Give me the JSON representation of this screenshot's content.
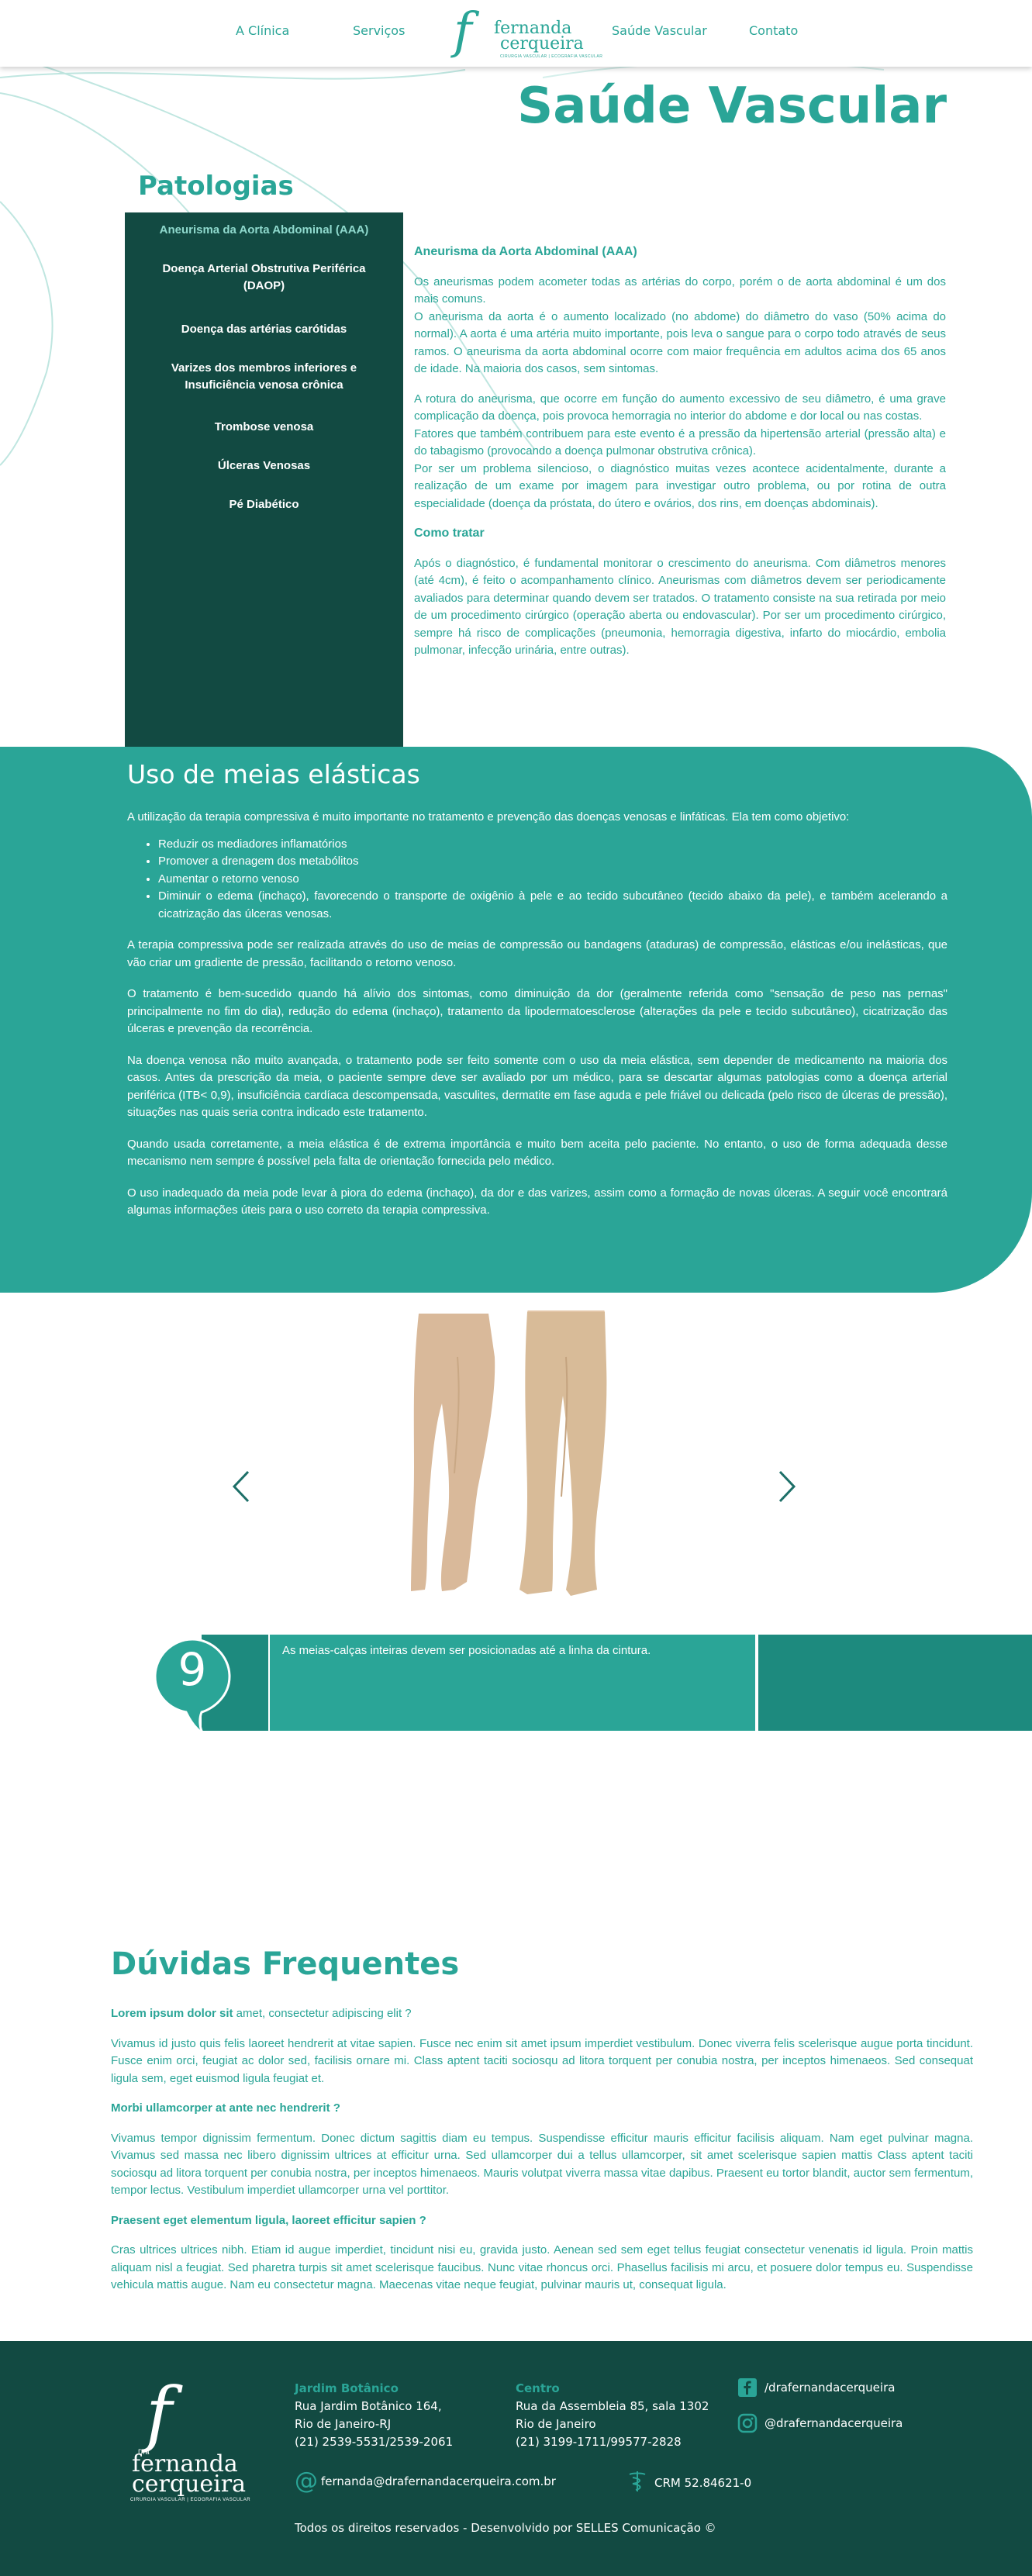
{
  "nav": {
    "clinica": "A Clínica",
    "servicos": "Serviços",
    "saude_vascular": "Saúde Vascular",
    "contato": "Contato"
  },
  "logo": {
    "line1": "fernanda",
    "line2": "cerqueira",
    "tagline": "CIRURGIA VASCULAR | ECOGRAFIA VASCULAR"
  },
  "page_title": "Saúde Vascular",
  "patologias": {
    "title": "Patologias",
    "items": [
      "Aneurisma da Aorta Abdominal (AAA)",
      "Doença Arterial Obstrutiva Periférica (DAOP)",
      "Doença das artérias carótidas",
      "Varizes dos membros inferiores e Insuficiência venosa crônica",
      "Trombose venosa",
      "Úlceras Venosas",
      "Pé Diabético"
    ]
  },
  "content": {
    "heading": "Aneurisma da Aorta Abdominal (AAA)",
    "p1": "Os aneurismas podem acometer todas as artérias do corpo, porém o de aorta abdominal é um dos mais comuns.",
    "p2": "O aneurisma da aorta é o aumento localizado (no abdome) do diâmetro do vaso (50% acima do normal). A aorta é uma artéria muito importante, pois leva o sangue para o corpo todo através de seus ramos. O aneurisma da aorta abdominal ocorre com maior frequência em adultos acima dos 65 anos de idade. Na maioria dos casos, sem sintomas.",
    "p3": "A rotura do aneurisma, que ocorre em função do aumento excessivo de seu diâmetro, é uma grave complicação da doença, pois provoca hemorragia no interior do abdome e dor local ou nas costas.",
    "p4": "Fatores que também contribuem para este evento é a pressão da hipertensão arterial (pressão alta) e do tabagismo (provocando a doença pulmonar obstrutiva crônica).",
    "p5": "Por ser um problema silencioso, o diagnóstico muitas vezes acontece acidentalmente, durante a realização de um exame por imagem para investigar outro problema, ou por rotina de outra especialidade (doença da próstata, do útero e ovários, dos rins, em doenças abdominais).",
    "heading2": "Como tratar",
    "p6": "Após o diagnóstico, é fundamental monitorar o crescimento do aneurisma. Com diâmetros menores (até 4cm), é feito o acompanhamento clínico. Aneurismas com diâmetros devem ser periodicamente avaliados para determinar quando devem ser tratados. O tratamento consiste na sua retirada por meio de um procedimento cirúrgico (operação aberta ou endovascular). Por ser um procedimento cirúrgico, sempre há risco de complicações (pneumonia, hemorragia digestiva, infarto do miocárdio, embolia pulmonar, infecção urinária, entre outras)."
  },
  "meias": {
    "title": "Uso de meias elásticas",
    "intro": "A utilização da terapia compressiva é muito importante no tratamento e prevenção das doenças venosas e linfáticas. Ela tem como objetivo:",
    "bullets": [
      "Reduzir os mediadores inflamatórios",
      "Promover a drenagem dos metabólitos",
      "Aumentar o retorno venoso",
      "Diminuir o edema (inchaço), favorecendo o transporte de oxigênio à pele e ao tecido subcutâneo (tecido abaixo da pele), e também acelerando a cicatrização das úlceras venosas."
    ],
    "p1": "A terapia compressiva pode ser realizada através do uso de meias de compressão ou bandagens (ataduras) de compressão, elásticas e/ou inelásticas, que vão criar um gradiente de pressão, facilitando o retorno venoso.",
    "p2": "O tratamento é bem-sucedido quando há alívio dos sintomas, como diminuição da dor (geralmente referida como \"sensação de peso nas pernas\" principalmente no fim do dia), redução do edema (inchaço), tratamento da lipodermatoesclerose (alterações da pele e tecido subcutâneo), cicatrização das úlceras e prevenção da recorrência.",
    "p3": "Na doença venosa não muito avançada, o tratamento pode ser feito somente com o uso da meia elástica, sem depender de medicamento na maioria dos casos. Antes da prescrição da meia, o paciente sempre deve ser avaliado por um médico, para se descartar algumas patologias como a doença arterial periférica (ITB< 0,9), insuficiência cardíaca descompensada, vasculites, dermatite em fase aguda e pele friável ou delicada (pelo risco de úlceras de pressão), situações nas quais seria contra indicado este tratamento.",
    "p4": "Quando usada corretamente, a meia elástica é de extrema importância e muito bem aceita pelo paciente. No entanto, o uso de forma adequada desse mecanismo nem sempre é possível pela falta de orientação fornecida pelo médico.",
    "p5": "O uso inadequado da meia pode levar à piora do edema (inchaço), da dor e das varizes, assim como a formação de novas úlceras. A seguir você encontrará algumas informações úteis para o uso correto da terapia compressiva."
  },
  "carousel": {
    "tip_number": "9",
    "tip_text": "As meias-calças inteiras devem ser posicionadas até a linha da cintura.",
    "prev_icon": "chevron-left-icon",
    "next_icon": "chevron-right-icon"
  },
  "faq": {
    "title": "Dúvidas Frequentes",
    "items": [
      {
        "q_bold": "Lorem ipsum dolor sit",
        "q_rest": " amet, consectetur adipiscing elit ?",
        "a": "Vivamus id justo quis felis laoreet hendrerit at vitae sapien. Fusce nec enim sit amet ipsum imperdiet vestibulum. Donec viverra felis scelerisque augue porta tincidunt. Fusce enim orci, feugiat ac dolor sed, facilisis ornare mi. Class aptent taciti sociosqu ad litora torquent per conubia nostra, per inceptos himenaeos. Sed consequat ligula sem, eget euismod ligula feugiat et."
      },
      {
        "q_bold": "Morbi ullamcorper at ante nec hendrerit ?",
        "q_rest": "",
        "a": "Vivamus tempor dignissim fermentum. Donec dictum sagittis diam eu tempus. Suspendisse efficitur mauris efficitur facilisis aliquam. Nam eget pulvinar magna. Vivamus sed massa nec libero dignissim ultrices at efficitur urna. Sed ullamcorper dui a tellus ullamcorper, sit amet scelerisque sapien mattis Class aptent taciti sociosqu ad litora torquent per conubia nostra, per inceptos himenaeos. Mauris volutpat viverra massa vitae dapibus. Praesent eu tortor blandit, auctor sem fermentum, tempor lectus. Vestibulum imperdiet ullamcorper urna vel porttitor."
      },
      {
        "q_bold": "Praesent eget elementum ligula, laoreet efficitur sapien ?",
        "q_rest": "",
        "a": "Cras ultrices ultrices nibh. Etiam id augue imperdiet, tincidunt nisi eu, gravida justo. Aenean sed sem eget tellus feugiat consectetur venenatis id ligula. Proin mattis aliquam nisl a feugiat. Sed pharetra turpis sit amet scelerisque faucibus. Nunc vitae rhoncus orci. Phasellus facilisis mi arcu, et posuere dolor tempus eu. Suspendisse vehicula mattis augue. Nam eu consectetur magna. Maecenas vitae neque feugiat, pulvinar mauris ut, consequat ligula."
      }
    ]
  },
  "footer": {
    "logo_pre": "Dra",
    "logo_line1": "fernanda",
    "logo_line2": "cerqueira",
    "logo_tag": "CIRURGIA VASCULAR | ECOGRAFIA VASCULAR",
    "addr1": {
      "title": "Jardim Botânico",
      "l1": "Rua Jardim Botânico 164,",
      "l2": "Rio de Janeiro-RJ",
      "l3": "(21) 2539-5531/2539-2061"
    },
    "addr2": {
      "title": "Centro",
      "l1": "Rua da Assembleia 85, sala 1302",
      "l2": "Rio de Janeiro",
      "l3": "(21) 3199-1711/99577-2828"
    },
    "facebook": "/drafernandacerqueira",
    "instagram": "@drafernandacerqueira",
    "email": "fernanda@drafernandacerqueira.com.br",
    "crm": "CRM 52.84621-0",
    "copyright": "Todos os direitos reservados - Desenvolvido por SELLES Comunicação ©"
  },
  "colors": {
    "primary": "#2aa597",
    "dark": "#124a42"
  }
}
